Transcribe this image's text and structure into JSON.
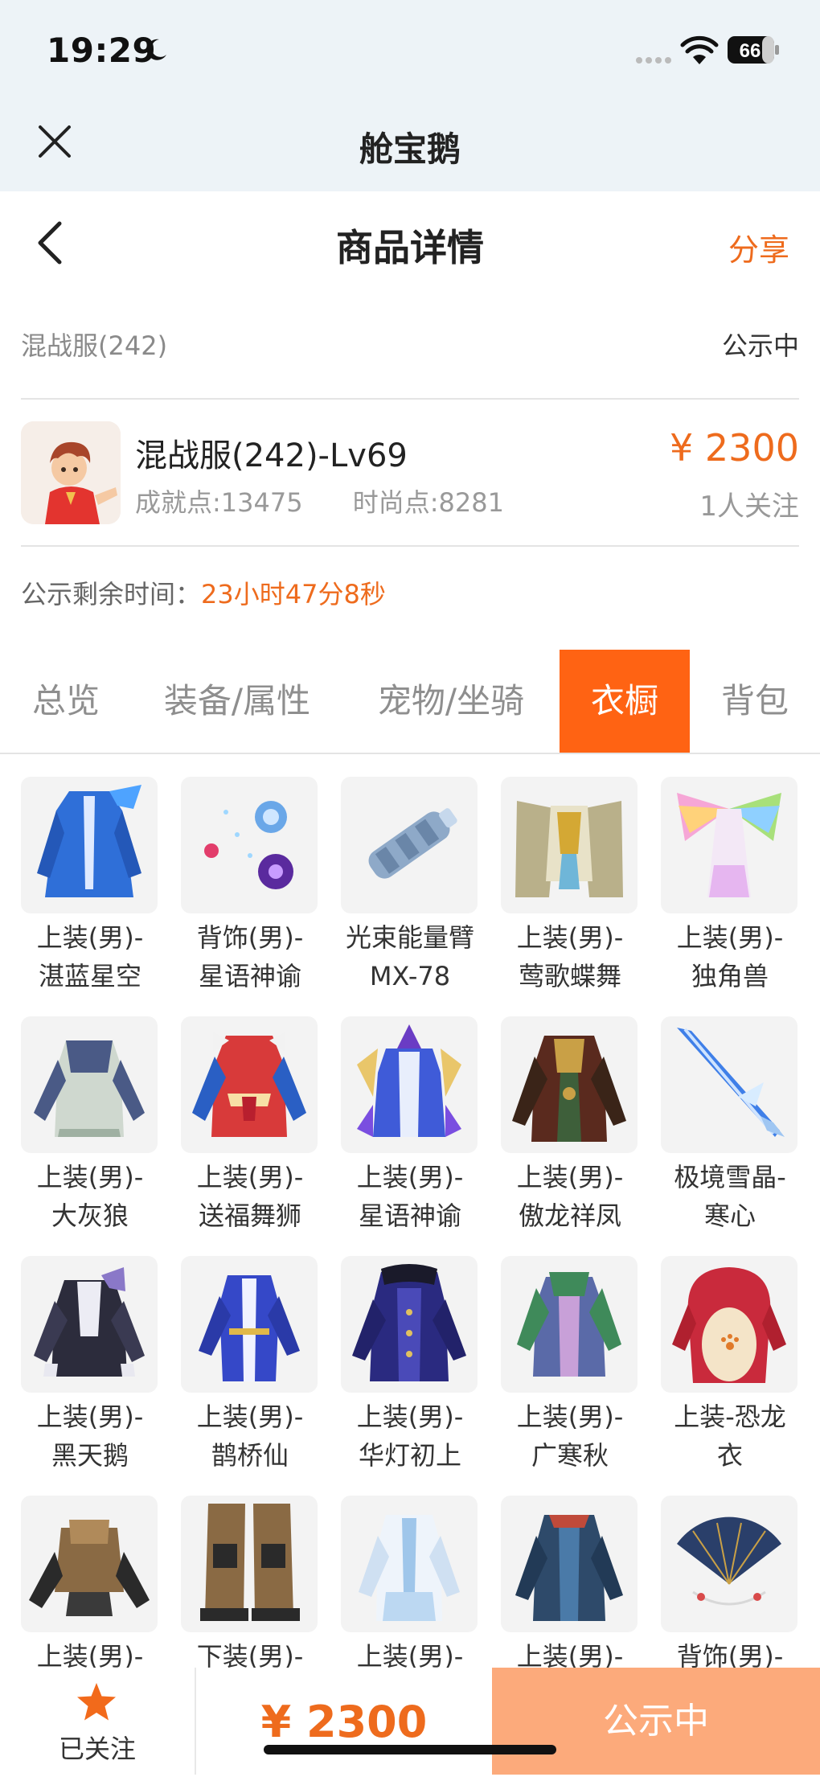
{
  "status_bar": {
    "time": "19:29",
    "battery": "66"
  },
  "miniprogram": {
    "title": "舱宝鹅"
  },
  "header": {
    "title": "商品详情",
    "share_label": "分享"
  },
  "server": {
    "name": "混战服(242)",
    "status": "公示中"
  },
  "character": {
    "name": "混战服(242)-Lv69",
    "achievement": "成就点:13475",
    "fashion": "时尚点:8281",
    "price": "¥ 2300",
    "followers": "1人关注"
  },
  "remaining": {
    "label": "公示剩余时间：",
    "value": "23小时47分8秒"
  },
  "tabs": [
    {
      "label": "总览",
      "active": false
    },
    {
      "label": "装备/属性",
      "active": false
    },
    {
      "label": "宠物/坐骑",
      "active": false
    },
    {
      "label": "衣橱",
      "active": true
    },
    {
      "label": "背包",
      "active": false
    }
  ],
  "items": [
    {
      "line1": "上装(男)-",
      "line2": "湛蓝星空",
      "icon": "blue-coat"
    },
    {
      "line1": "背饰(男)-",
      "line2": "星语神谕",
      "icon": "orbs"
    },
    {
      "line1": "光束能量臂",
      "line2": "MX-78",
      "icon": "arm-cannon"
    },
    {
      "line1": "上装(男)-",
      "line2": "莺歌蝶舞",
      "icon": "winged-armor"
    },
    {
      "line1": "上装(男)-",
      "line2": "独角兽",
      "icon": "rainbow-wings"
    },
    {
      "line1": "上装(男)-",
      "line2": "大灰狼",
      "icon": "grey-coat"
    },
    {
      "line1": "上装(男)-",
      "line2": "送福舞狮",
      "icon": "lion-coat"
    },
    {
      "line1": "上装(男)-",
      "line2": "星语神谕",
      "icon": "star-armor"
    },
    {
      "line1": "上装(男)-",
      "line2": "傲龙祥凤",
      "icon": "dragon-robe"
    },
    {
      "line1": "极境雪晶-",
      "line2": "寒心",
      "icon": "ice-sword"
    },
    {
      "line1": "上装(男)-",
      "line2": "黑天鹅",
      "icon": "black-coat"
    },
    {
      "line1": "上装(男)-",
      "line2": "鹊桥仙",
      "icon": "blue-robe"
    },
    {
      "line1": "上装(男)-",
      "line2": "华灯初上",
      "icon": "navy-coat"
    },
    {
      "line1": "上装(男)-",
      "line2": "广寒秋",
      "icon": "green-robe"
    },
    {
      "line1": "上装-恐龙",
      "line2": "衣",
      "icon": "dino-suit"
    },
    {
      "line1": "上装(男)-",
      "line2": "",
      "icon": "mech-top"
    },
    {
      "line1": "下装(男)-",
      "line2": "",
      "icon": "mech-legs"
    },
    {
      "line1": "上装(男)-",
      "line2": "",
      "icon": "white-coat"
    },
    {
      "line1": "上装(男)-",
      "line2": "",
      "icon": "teal-coat"
    },
    {
      "line1": "背饰(男)-",
      "line2": "",
      "icon": "fan"
    }
  ],
  "bottom_bar": {
    "follow_label": "已关注",
    "price": "¥ 2300",
    "status": "公示中"
  },
  "colors": {
    "accent": "#ee6b1d",
    "tab_active": "#ff6313",
    "status_button": "#fcaa7b"
  }
}
